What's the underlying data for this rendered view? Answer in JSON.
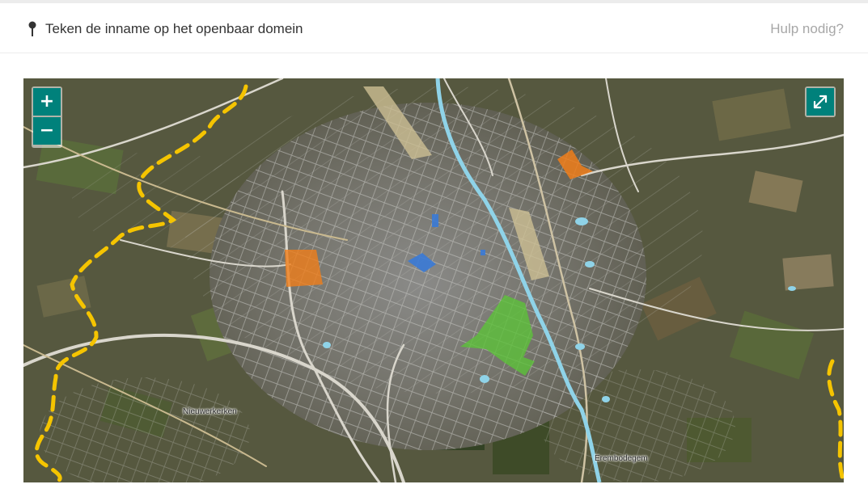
{
  "header": {
    "title": "Teken de inname op het openbaar domein",
    "help_link": "Hulp nodig?",
    "pin_icon": "map-pin-icon"
  },
  "map": {
    "zoom_in_label": "+",
    "zoom_out_label": "−",
    "fullscreen_icon": "expand-icon",
    "place_labels": {
      "nieuwerkerken": "Nieuwerkerken",
      "erembodegem": "Erembodegem"
    },
    "colors": {
      "accent": "#00817b",
      "municipal_boundary": "#f5c400",
      "orange_zone": "#f07e1a",
      "green_zone": "#5cc23a",
      "blue_zone": "#3a7ad6",
      "river": "#8fd3e8"
    }
  }
}
